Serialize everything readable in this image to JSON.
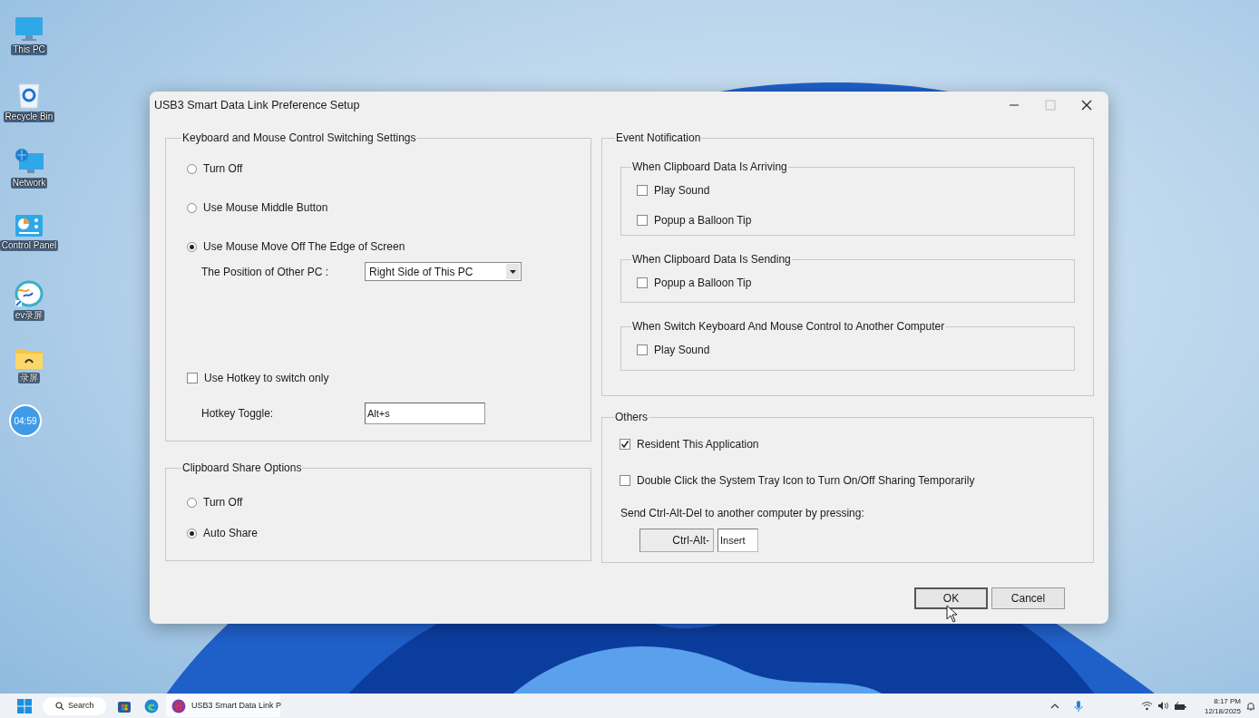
{
  "desktop_icons": [
    {
      "kind": "monitor",
      "label": "This PC"
    },
    {
      "kind": "recycle",
      "label": "Recycle Bin"
    },
    {
      "kind": "network",
      "label": "Network"
    },
    {
      "kind": "panel",
      "label": "Control Panel"
    },
    {
      "kind": "recorder",
      "label": "ev录屏"
    },
    {
      "kind": "folder",
      "label": "录屏"
    }
  ],
  "clock_widget": {
    "time": "04:59"
  },
  "dialog": {
    "title": "USB3 Smart Data Link Preference Setup",
    "keyboard_mouse": {
      "title": "Keyboard and Mouse Control Switching Settings",
      "options": [
        {
          "label": "Turn Off",
          "selected": false
        },
        {
          "label": "Use Mouse Middle Button",
          "selected": false
        },
        {
          "label": "Use Mouse Move Off The Edge of Screen",
          "selected": true
        }
      ],
      "position": {
        "label": "The Position of Other PC :",
        "value": "Right Side of This PC"
      },
      "hotkey_only": {
        "label": "Use Hotkey to switch only",
        "checked": false
      },
      "hotkey_toggle": {
        "label": "Hotkey Toggle:",
        "value": "Alt+s"
      }
    },
    "clipboard": {
      "title": "Clipboard Share Options",
      "options": [
        {
          "label": "Turn Off",
          "selected": false
        },
        {
          "label": "Auto Share",
          "selected": true
        }
      ]
    },
    "event_notification": {
      "title": "Event Notification",
      "groups": [
        {
          "title": "When Clipboard Data Is Arriving",
          "items": [
            {
              "label": "Play Sound",
              "checked": false
            },
            {
              "label": "Popup a Balloon Tip",
              "checked": false
            }
          ]
        },
        {
          "title": "When Clipboard Data Is Sending",
          "items": [
            {
              "label": "Popup a Balloon Tip",
              "checked": false
            }
          ]
        },
        {
          "title": "When Switch Keyboard And Mouse Control to Another Computer",
          "items": [
            {
              "label": "Play Sound",
              "checked": false
            }
          ]
        }
      ]
    },
    "others": {
      "title": "Others",
      "checkboxes": [
        {
          "label": "Resident This Application",
          "checked": true
        },
        {
          "label": "Double Click the System Tray Icon to Turn On/Off Sharing Temporarily",
          "checked": false
        }
      ],
      "ctrl_alt_del": {
        "label": "Send Ctrl-Alt-Del to another computer by pressing:",
        "prefix": "Ctrl-Alt-",
        "value": "Insert"
      }
    },
    "buttons": [
      {
        "label": "OK",
        "default": true
      },
      {
        "label": "Cancel",
        "default": false
      }
    ]
  },
  "taskbar": {
    "search": "Search",
    "app": "USB3 Smart Data Link P",
    "time": "8:17 PM",
    "date": "12/18/2025"
  }
}
